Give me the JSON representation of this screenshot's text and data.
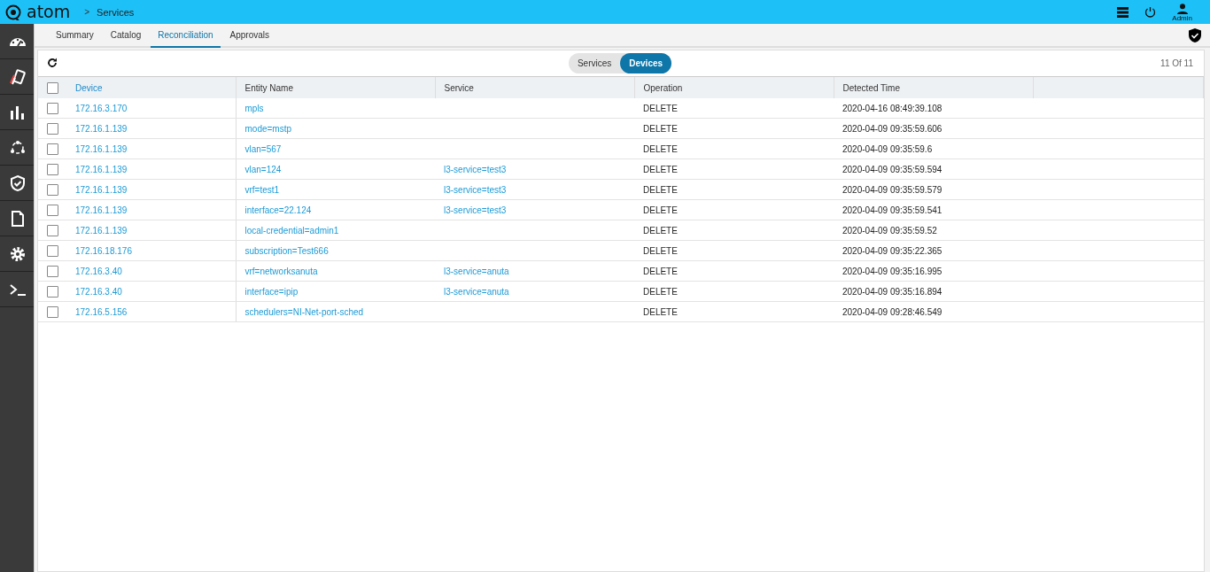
{
  "header": {
    "logo": "atom",
    "breadcrumb_separator": ">",
    "breadcrumb": "Services",
    "user": "Admin"
  },
  "sidebar": {
    "items": [
      {
        "kind": "dashboard"
      },
      {
        "kind": "cards"
      },
      {
        "kind": "chart"
      },
      {
        "kind": "network"
      },
      {
        "kind": "shield"
      },
      {
        "kind": "document"
      },
      {
        "kind": "settings"
      },
      {
        "kind": "terminal"
      }
    ]
  },
  "tabs": [
    {
      "label": "Summary",
      "selected": false
    },
    {
      "label": "Catalog",
      "selected": false
    },
    {
      "label": "Reconciliation",
      "selected": true
    },
    {
      "label": "Approvals",
      "selected": false
    }
  ],
  "toggle": [
    {
      "label": "Services",
      "selected": false
    },
    {
      "label": "Devices",
      "selected": true
    }
  ],
  "pager": "11 Of 11",
  "table": {
    "select_all_checked": false,
    "columns": [
      {
        "label": "Device",
        "sorted": true
      },
      {
        "label": "Entity Name",
        "sorted": false
      },
      {
        "label": "Service",
        "sorted": false
      },
      {
        "label": "Operation",
        "sorted": false
      },
      {
        "label": "Detected Time",
        "sorted": false
      }
    ],
    "rows": [
      {
        "checked": false,
        "device": "172.16.3.170",
        "entity": "mpls",
        "service": "",
        "operation": "DELETE",
        "time": "2020-04-16 08:49:39.108"
      },
      {
        "checked": false,
        "device": "172.16.1.139",
        "entity": "mode=mstp",
        "service": "",
        "operation": "DELETE",
        "time": "2020-04-09 09:35:59.606"
      },
      {
        "checked": false,
        "device": "172.16.1.139",
        "entity": "vlan=567",
        "service": "",
        "operation": "DELETE",
        "time": "2020-04-09 09:35:59.6"
      },
      {
        "checked": false,
        "device": "172.16.1.139",
        "entity": "vlan=124",
        "service": "l3-service=test3",
        "operation": "DELETE",
        "time": "2020-04-09 09:35:59.594"
      },
      {
        "checked": false,
        "device": "172.16.1.139",
        "entity": "vrf=test1",
        "service": "l3-service=test3",
        "operation": "DELETE",
        "time": "2020-04-09 09:35:59.579"
      },
      {
        "checked": false,
        "device": "172.16.1.139",
        "entity": "interface=22.124",
        "service": "l3-service=test3",
        "operation": "DELETE",
        "time": "2020-04-09 09:35:59.541"
      },
      {
        "checked": false,
        "device": "172.16.1.139",
        "entity": "local-credential=admin1",
        "service": "",
        "operation": "DELETE",
        "time": "2020-04-09 09:35:59.52"
      },
      {
        "checked": false,
        "device": "172.16.18.176",
        "entity": "subscription=Test666",
        "service": "",
        "operation": "DELETE",
        "time": "2020-04-09 09:35:22.365"
      },
      {
        "checked": false,
        "device": "172.16.3.40",
        "entity": "vrf=networksanuta",
        "service": "l3-service=anuta",
        "operation": "DELETE",
        "time": "2020-04-09 09:35:16.995"
      },
      {
        "checked": false,
        "device": "172.16.3.40",
        "entity": "interface=ipip",
        "service": "l3-service=anuta",
        "operation": "DELETE",
        "time": "2020-04-09 09:35:16.894"
      },
      {
        "checked": false,
        "device": "172.16.5.156",
        "entity": "schedulers=NI-Net-port-sched",
        "service": "",
        "operation": "DELETE",
        "time": "2020-04-09 09:28:46.549"
      }
    ]
  }
}
